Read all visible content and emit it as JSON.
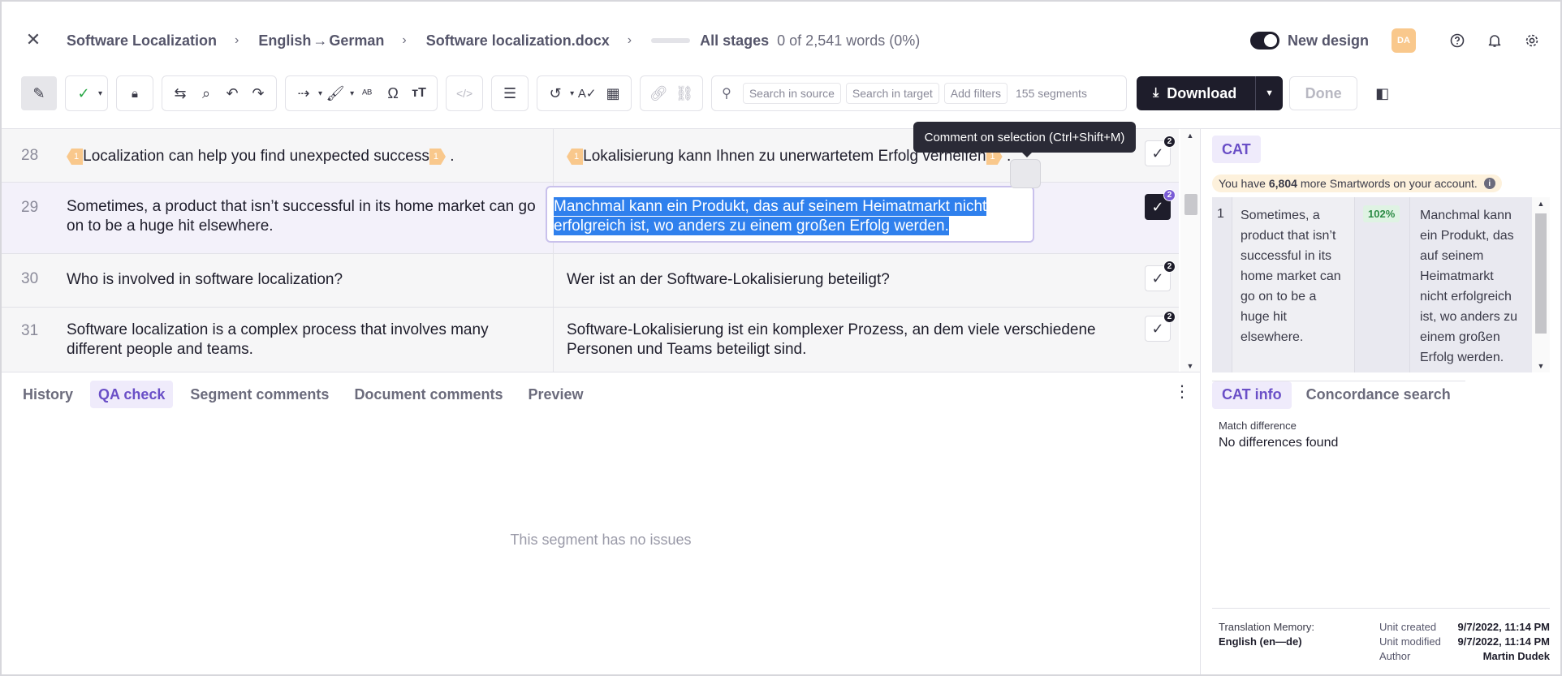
{
  "header": {
    "close_icon": "close-icon",
    "breadcrumbs": {
      "project": "Software Localization",
      "lang_from": "English",
      "lang_arrow": "→",
      "lang_to": "German",
      "file": "Software localization.docx"
    },
    "stage_label": "All stages",
    "stage_count": "0 of 2,541 words",
    "stage_pct": "(0%)",
    "stage_progress": 0,
    "new_design_label": "New design",
    "new_design_on": true,
    "avatar_initials": "DA",
    "avatar_color": "#f9c88c"
  },
  "toolbar": {
    "search_source": "Search in source",
    "search_target": "Search in target",
    "add_filters": "Add filters",
    "segment_count": "155 segments",
    "download_label": "Download",
    "done_label": "Done"
  },
  "tooltip": "Comment on selection (Ctrl+Shift+M)",
  "segments": [
    {
      "num": "28",
      "src_tag_open": "1",
      "src_text": "Localization can help you find unexpected success",
      "src_tag_close": "1",
      "src_tail": ".",
      "tgt_tag_open": "1",
      "tgt_text": "Lokalisierung kann Ihnen zu unerwartetem Erfolg verhelfen",
      "tgt_tag_close": "1",
      "tgt_tail": ".",
      "comments": "2"
    },
    {
      "num": "29",
      "src_text": "Sometimes, a product that isn’t successful in its home market can go on to be a huge hit elsewhere.",
      "tgt_line1": "Manchmal kann ein Produkt, das auf seinem Heimatmarkt nicht",
      "tgt_line2": "erfolgreich ist, wo anders zu einem großen Erfolg werden.",
      "comments": "2"
    },
    {
      "num": "30",
      "src_text": "Who is involved in software localization?",
      "tgt_text": "Wer ist an der Software-Lokalisierung beteiligt?",
      "comments": "2"
    },
    {
      "num": "31",
      "src_text": "Software localization is a complex process that involves many different people and teams.",
      "tgt_text": "Software-Lokalisierung ist ein komplexer Prozess, an dem viele verschiedene Personen und Teams beteiligt sind.",
      "comments": "2"
    }
  ],
  "bottom_panel": {
    "tabs": [
      "History",
      "QA check",
      "Segment comments",
      "Document comments",
      "Preview"
    ],
    "active_tab": "QA check",
    "empty_message": "This segment has no issues"
  },
  "cat_panel": {
    "tab_label": "CAT",
    "smartwords_prefix": "You have",
    "smartwords_count": "6,804",
    "smartwords_suffix": "more Smartwords on your account.",
    "match": {
      "num": "1",
      "source": "Sometimes, a product that isn’t successful in its home market can go on to be a huge hit elsewhere.",
      "percent": "102%",
      "target": "Manchmal kann ein Produkt, das auf seinem Heimatmarkt nicht erfolgreich ist, wo anders zu einem großen Erfolg werden."
    },
    "info_tabs": [
      "CAT info",
      "Concordance search"
    ],
    "match_diff_label": "Match difference",
    "match_diff_value": "No differences found",
    "tm_label": "Translation Memory:",
    "tm_value": "English  (en—de)",
    "unit_created_label": "Unit created",
    "unit_created": "9/7/2022, 11:14 PM",
    "unit_modified_label": "Unit modified",
    "unit_modified": "9/7/2022, 11:14 PM",
    "author_label": "Author",
    "author": "Martin Dudek"
  }
}
